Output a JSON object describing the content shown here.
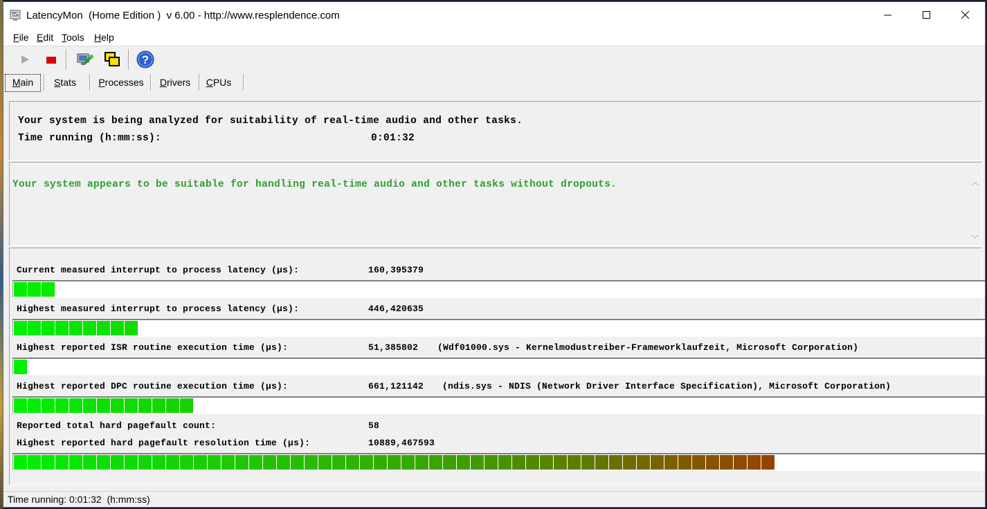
{
  "window": {
    "title": "LatencyMon  (Home Edition )  v 6.00 - http://www.resplendence.com"
  },
  "menu": [
    {
      "label_u": "F",
      "label_rest": "ile"
    },
    {
      "label_u": "E",
      "label_rest": "dit"
    },
    {
      "label_u": "T",
      "label_rest": "ools"
    },
    {
      "label_u": "H",
      "label_rest": "elp"
    }
  ],
  "toolbar": {
    "icons": [
      "play-icon",
      "stop-icon",
      "analyze-icon",
      "windows-icon",
      "help-icon"
    ]
  },
  "tabs": [
    {
      "label_u": "M",
      "label_rest": "ain",
      "active": true
    },
    {
      "label_u": "S",
      "label_rest": "tats"
    },
    {
      "label_u": "P",
      "label_rest": "rocesses"
    },
    {
      "label_u": "D",
      "label_rest": "rivers"
    },
    {
      "label_u": "C",
      "label_rest": "PUs"
    }
  ],
  "summary": {
    "line1": "Your system is being analyzed for suitability of real-time audio and other tasks.",
    "time_label": "Time running (h:mm:ss):",
    "time_value": "0:01:32"
  },
  "verdict": {
    "text": "Your system appears to be suitable for handling real-time audio and other tasks without dropouts.",
    "color": "#2aa12a"
  },
  "metrics": {
    "current_latency": {
      "label": "Current measured interrupt to process latency (µs):",
      "value": "160,395379",
      "segments": 3
    },
    "highest_latency": {
      "label": "Highest measured interrupt to process latency (µs):",
      "value": "446,420635",
      "segments": 9
    },
    "isr": {
      "label": "Highest reported ISR routine execution time (µs):",
      "value": "51,385802",
      "extra": "(Wdf01000.sys - Kernelmodustreiber-Frameworklaufzeit, Microsoft Corporation)",
      "segments": 1
    },
    "dpc": {
      "label": "Highest reported DPC routine execution time (µs):",
      "value": "661,121142",
      "extra": "(ndis.sys - NDIS (Network Driver Interface Specification), Microsoft Corporation)",
      "segments": 13
    },
    "pagefault_count": {
      "label": "Reported total hard pagefault count:",
      "value": "58"
    },
    "pagefault_time": {
      "label": "Highest reported hard pagefault resolution time (µs):",
      "value": "10889,467593",
      "segments": 55
    }
  },
  "statusbar": {
    "text": "Time running: 0:01:32  (h:mm:ss)"
  },
  "colors": {
    "bar_start": "#00f000",
    "bar_mid": "#3ca000",
    "bar_end": "#d80000"
  }
}
